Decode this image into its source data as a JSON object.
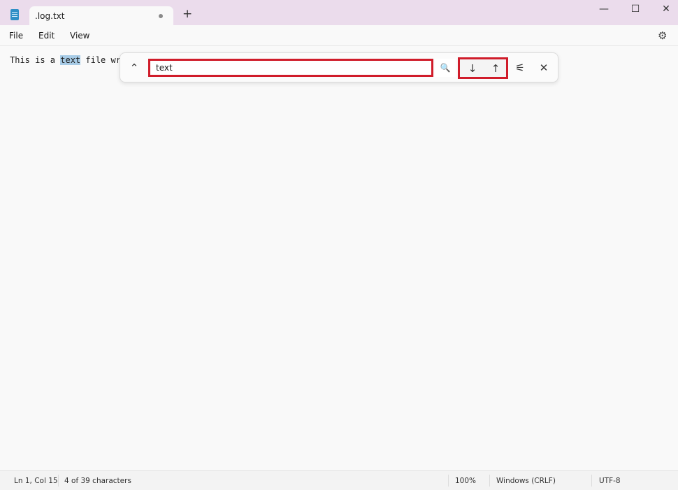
{
  "tab": {
    "title": ".log.txt",
    "unsaved_indicator": "•",
    "new_tab": "+"
  },
  "window_controls": {
    "minimize": "—",
    "maximize": "☐",
    "close": "✕"
  },
  "menu": {
    "items": [
      "File",
      "Edit",
      "View"
    ],
    "settings_icon": "⚙"
  },
  "editor": {
    "before": "This is a ",
    "match": "text",
    "after": " file wri"
  },
  "find": {
    "expand_icon": "⌃",
    "query": "text",
    "search_icon": "🔍",
    "next_icon": "↓",
    "prev_icon": "↑",
    "options_icon": "⚟",
    "close_icon": "✕",
    "highlight_color": "#d01c2a"
  },
  "status": {
    "position": "Ln 1, Col 15",
    "selection": "4 of 39 characters",
    "zoom": "100%",
    "line_ending": "Windows (CRLF)",
    "encoding": "UTF-8"
  }
}
